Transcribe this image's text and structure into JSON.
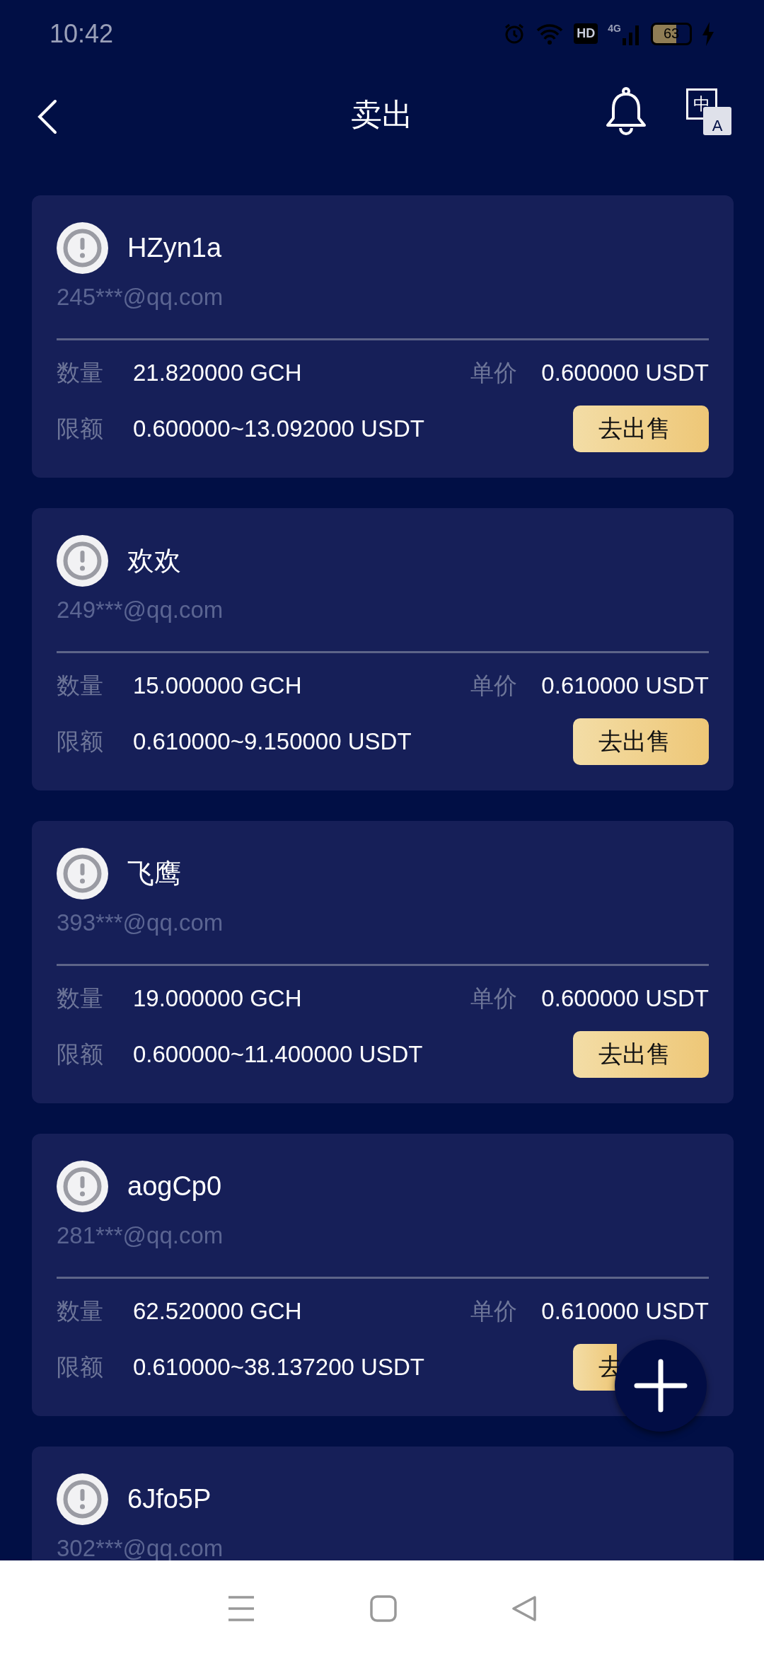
{
  "status_bar": {
    "time": "10:42",
    "hd": "HD",
    "network": "4G",
    "battery": "63"
  },
  "header": {
    "title": "卖出",
    "language_badge": "中",
    "language_badge_2": "A"
  },
  "offers": [
    {
      "name": "HZyn1a",
      "email": "245***@qq.com",
      "quantity_label": "数量",
      "quantity": "21.820000 GCH",
      "price_label": "单价",
      "price": "0.600000 USDT",
      "limit_label": "限额",
      "limit": "0.600000~13.092000 USDT",
      "button": "去出售"
    },
    {
      "name": "欢欢",
      "email": "249***@qq.com",
      "quantity_label": "数量",
      "quantity": "15.000000 GCH",
      "price_label": "单价",
      "price": "0.610000 USDT",
      "limit_label": "限额",
      "limit": "0.610000~9.150000 USDT",
      "button": "去出售"
    },
    {
      "name": "飞鹰",
      "email": "393***@qq.com",
      "quantity_label": "数量",
      "quantity": "19.000000 GCH",
      "price_label": "单价",
      "price": "0.600000 USDT",
      "limit_label": "限额",
      "limit": "0.600000~11.400000 USDT",
      "button": "去出售"
    },
    {
      "name": "aogCp0",
      "email": "281***@qq.com",
      "quantity_label": "数量",
      "quantity": "62.520000 GCH",
      "price_label": "单价",
      "price": "0.610000 USDT",
      "limit_label": "限额",
      "limit": "0.610000~38.137200 USDT",
      "button": "去",
      "button_covered": true
    },
    {
      "name": "6Jfo5P",
      "email": "302***@qq.com"
    }
  ]
}
